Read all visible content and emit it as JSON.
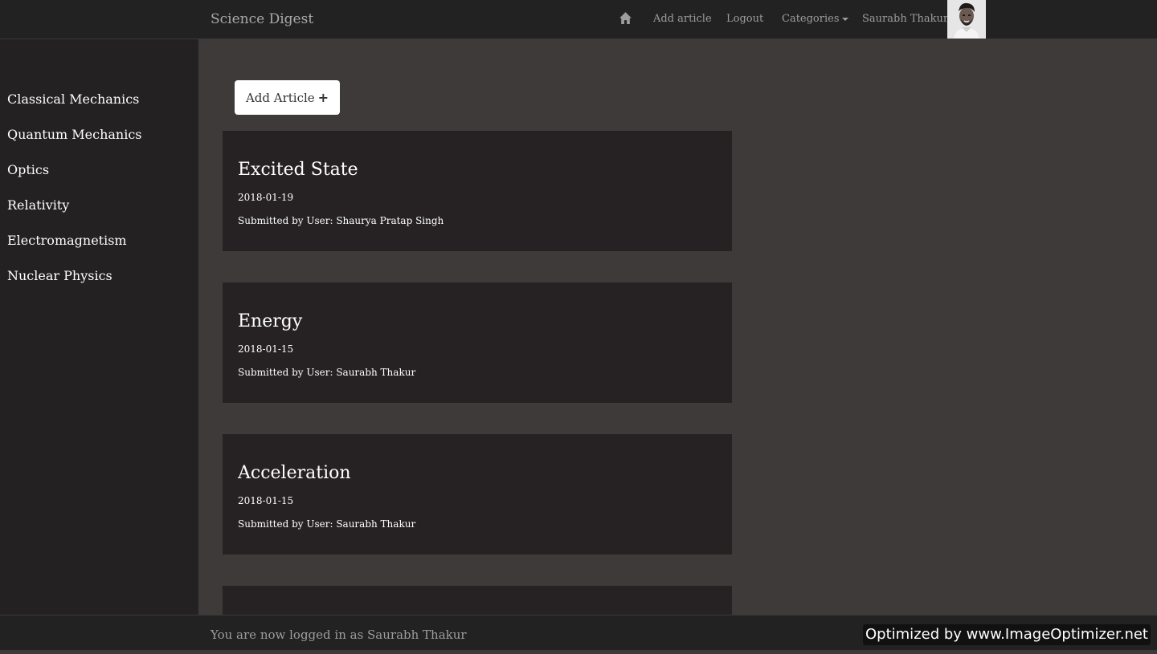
{
  "navbar": {
    "brand": "Science Digest",
    "home_icon": "home-icon",
    "links": {
      "add_article": "Add article",
      "logout": "Logout",
      "categories": "Categories",
      "user_name": "Saurabh Thakur"
    }
  },
  "sidebar": {
    "items": [
      {
        "label": "Classical Mechanics"
      },
      {
        "label": "Quantum Mechanics"
      },
      {
        "label": "Optics"
      },
      {
        "label": "Relativity"
      },
      {
        "label": "Electromagnetism"
      },
      {
        "label": "Nuclear Physics"
      }
    ]
  },
  "main": {
    "add_button_label": "Add Article",
    "add_button_icon": "plus-icon",
    "articles": [
      {
        "title": "Excited State",
        "date": "2018-01-19",
        "submitted": "Submitted by User: Shaurya Pratap Singh"
      },
      {
        "title": "Energy",
        "date": "2018-01-15",
        "submitted": "Submitted by User: Saurabh Thakur"
      },
      {
        "title": "Acceleration",
        "date": "2018-01-15",
        "submitted": "Submitted by User: Saurabh Thakur"
      }
    ]
  },
  "footer": {
    "status": "You are now logged in as Saurabh Thakur"
  },
  "watermark": "Optimized by www.ImageOptimizer.net",
  "colors": {
    "navbar_bg": "#222222",
    "sidebar_bg": "#232122",
    "main_bg": "#3e3a39",
    "card_bg": "#262223"
  }
}
